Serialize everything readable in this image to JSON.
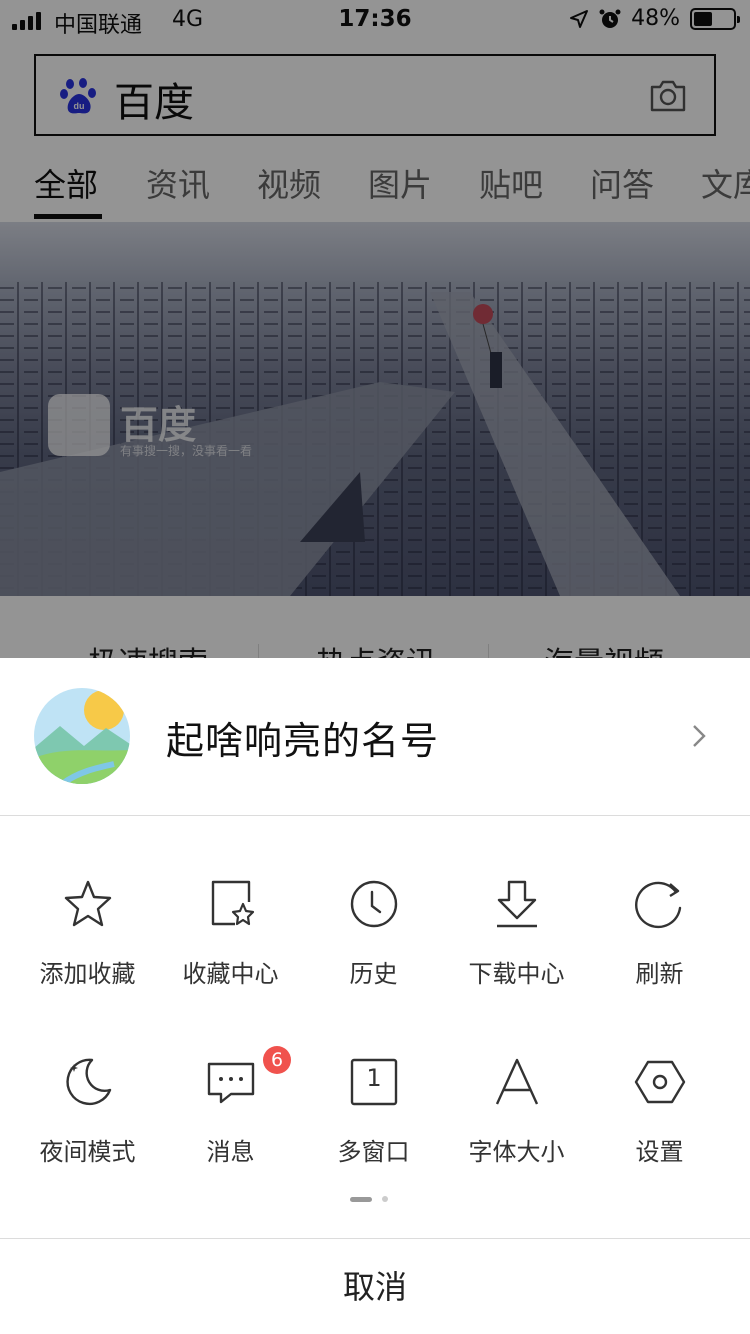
{
  "status_bar": {
    "carrier": "中国联通",
    "network": "4G",
    "time": "17:36",
    "battery_percent": "48%",
    "battery_level": 0.48,
    "icons": [
      "signal-icon",
      "location-arrow-icon",
      "alarm-icon",
      "battery-icon"
    ]
  },
  "search": {
    "query": "百度",
    "icons": [
      "baidu-paw-icon",
      "camera-icon"
    ]
  },
  "tabs": [
    "全部",
    "资讯",
    "视频",
    "图片",
    "贴吧",
    "问答",
    "文库"
  ],
  "active_tab": "全部",
  "hero": {
    "logo_text": "百度",
    "slogan": "有事搜一搜，没事看一看"
  },
  "quick_links": [
    "极速搜索",
    "热点资讯",
    "海量视频"
  ],
  "sheet": {
    "profile": {
      "name": "起啥响亮的名号"
    },
    "menu": [
      {
        "label": "添加收藏",
        "icon": "star-icon"
      },
      {
        "label": "收藏中心",
        "icon": "favorites-center-icon"
      },
      {
        "label": "历史",
        "icon": "history-clock-icon"
      },
      {
        "label": "下载中心",
        "icon": "download-icon"
      },
      {
        "label": "刷新",
        "icon": "refresh-icon"
      },
      {
        "label": "夜间模式",
        "icon": "night-mode-moon-icon"
      },
      {
        "label": "消息",
        "icon": "message-icon",
        "badge": "6"
      },
      {
        "label": "多窗口",
        "icon": "multi-window-icon",
        "window_count": "1"
      },
      {
        "label": "字体大小",
        "icon": "font-size-icon"
      },
      {
        "label": "设置",
        "icon": "settings-hexagon-icon"
      }
    ],
    "page_indicator": {
      "current": 1,
      "total": 2
    },
    "cancel_label": "取消"
  },
  "colors": {
    "badge": "#f0524d",
    "baidu_blue": "#2932e1",
    "overlay": "rgba(0,0,0,0.42)"
  }
}
